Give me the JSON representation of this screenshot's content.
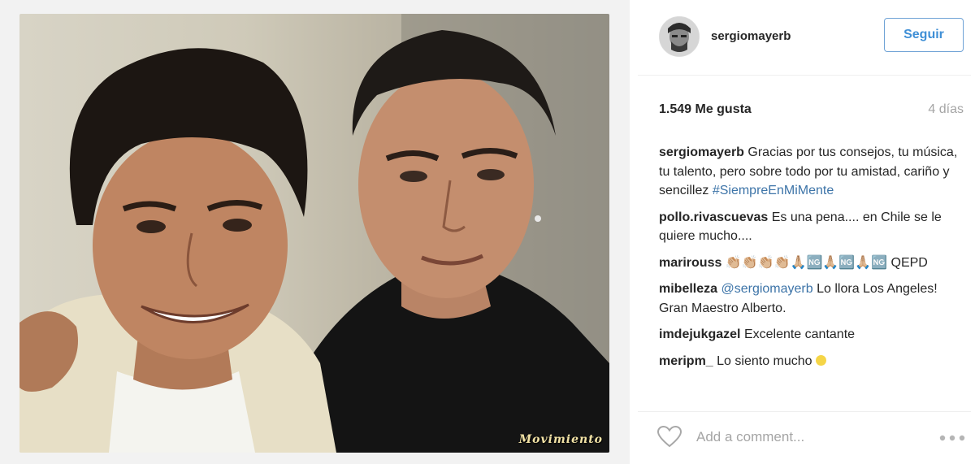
{
  "post": {
    "username": "sergiomayerb",
    "follow_label": "Seguir",
    "likes": "1.549 Me gusta",
    "time": "4 días",
    "watermark": "Movimiento"
  },
  "caption": {
    "user": "sergiomayerb",
    "text": "Gracias por tus consejos, tu música, tu talento, pero sobre todo por tu amistad, cariño y sencillez",
    "hashtag": "#SiempreEnMiMente"
  },
  "comments": [
    {
      "user": "pollo.rivascuevas",
      "text": "Es una pena.... en Chile se le quiere mucho...."
    },
    {
      "user": "marirouss",
      "text": "👏🏼👏🏼👏🏼👏🏼🙏🏼🆖🙏🏼🆖🙏🏼🆖",
      "suffix": "QEPD"
    },
    {
      "user": "mibelleza",
      "mention": "@sergiomayerb",
      "text": "Lo llora Los Angeles! Gran Maestro Alberto."
    },
    {
      "user": "imdejukgazel",
      "text": "Excelente cantante"
    },
    {
      "user": "meripm_",
      "text": "Lo siento mucho"
    }
  ],
  "footer": {
    "comment_placeholder": "Add a comment..."
  },
  "icons": {
    "like": "heart-icon",
    "more": "more-options-icon",
    "smiley": "smiley-emoji"
  },
  "colors": {
    "follow_button": "#3f8fd6",
    "hashtag": "#3d74a8",
    "muted": "#a5a5a5"
  }
}
